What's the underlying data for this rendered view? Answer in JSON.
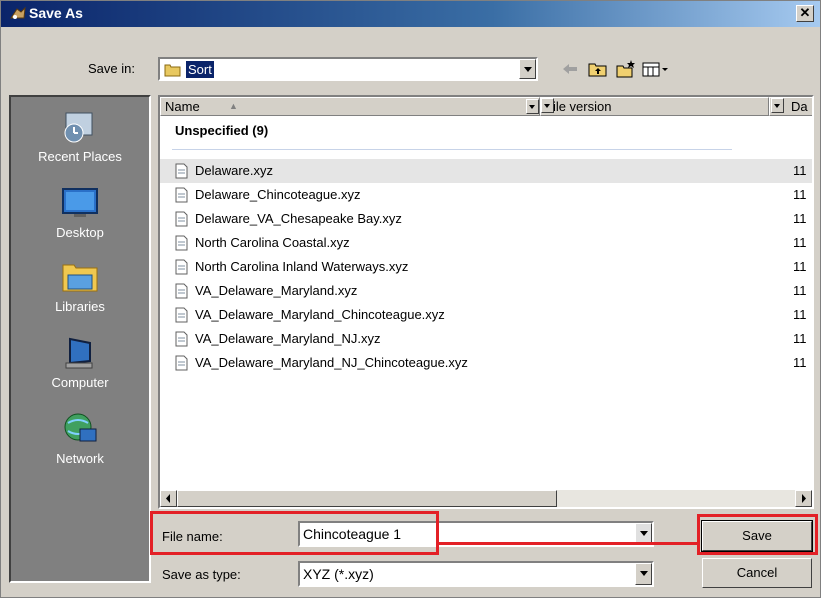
{
  "window": {
    "title": "Save As",
    "close_label": "✕"
  },
  "save_in": {
    "label": "Save in:",
    "value": "Sort"
  },
  "toolbar": {
    "icons": [
      "back-arrow-icon",
      "up-folder-icon",
      "new-folder-icon",
      "view-menu-icon"
    ]
  },
  "places": [
    {
      "label": "Recent Places",
      "icon": "recent-places-icon"
    },
    {
      "label": "Desktop",
      "icon": "desktop-icon"
    },
    {
      "label": "Libraries",
      "icon": "libraries-icon"
    },
    {
      "label": "Computer",
      "icon": "computer-icon"
    },
    {
      "label": "Network",
      "icon": "network-icon"
    }
  ],
  "file_list": {
    "columns": [
      "Name",
      "File version",
      "Da"
    ],
    "group": "Unspecified (9)",
    "files": [
      {
        "name": "Delaware.xyz",
        "version": "11"
      },
      {
        "name": "Delaware_Chincoteague.xyz",
        "version": "11"
      },
      {
        "name": "Delaware_VA_Chesapeake Bay.xyz",
        "version": "11"
      },
      {
        "name": "North Carolina Coastal.xyz",
        "version": "11"
      },
      {
        "name": "North Carolina Inland Waterways.xyz",
        "version": "11"
      },
      {
        "name": "VA_Delaware_Maryland.xyz",
        "version": "11"
      },
      {
        "name": "VA_Delaware_Maryland_Chincoteague.xyz",
        "version": "11"
      },
      {
        "name": "VA_Delaware_Maryland_NJ.xyz",
        "version": "11"
      },
      {
        "name": "VA_Delaware_Maryland_NJ_Chincoteague.xyz",
        "version": "11"
      }
    ]
  },
  "file_name": {
    "label": "File name:",
    "value": "Chincoteague 1"
  },
  "save_as_type": {
    "label": "Save as type:",
    "value": "XYZ (*.xyz)"
  },
  "buttons": {
    "save": "Save",
    "cancel": "Cancel"
  },
  "colors": {
    "highlight": "#e32026",
    "title_bar": "#0a246a",
    "dialog": "#d4d0c8"
  }
}
